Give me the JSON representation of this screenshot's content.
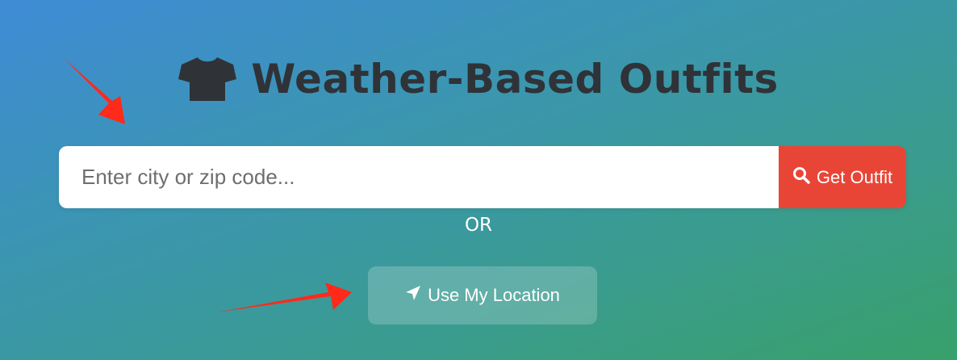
{
  "header": {
    "title": "Weather-Based Outfits",
    "icon": "tshirt-icon"
  },
  "search": {
    "placeholder": "Enter city or zip code...",
    "value": "",
    "button_label": "Get Outfit",
    "button_icon": "search-icon"
  },
  "divider_text": "OR",
  "location": {
    "button_label": "Use My Location",
    "button_icon": "location-arrow-icon"
  },
  "colors": {
    "background_start": "#3f8bd6",
    "background_end": "#38a06a",
    "title": "#2f3338",
    "primary_button": "#e94537",
    "annotation_arrow": "#ff2a1a"
  }
}
